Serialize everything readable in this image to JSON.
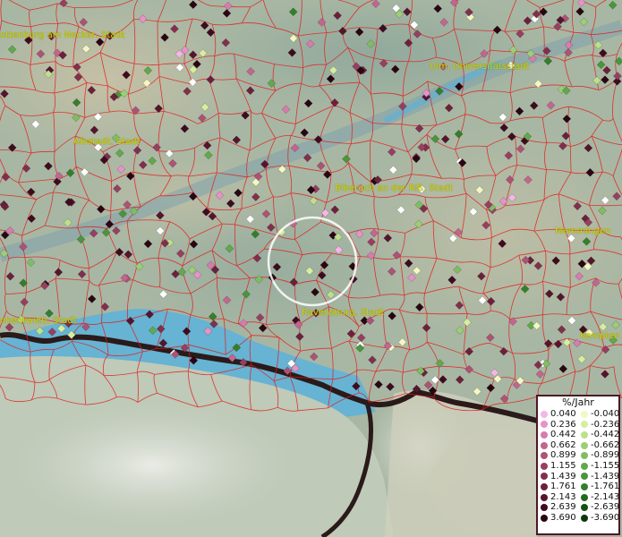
{
  "map": {
    "cities": [
      {
        "id": "rottenburg",
        "label": "ottenburg am Neckar, Stadt"
      },
      {
        "id": "ulm",
        "label": "Ulm, Universitätsstadt"
      },
      {
        "id": "albstadt",
        "label": "Albstadt, Stadt"
      },
      {
        "id": "biberach",
        "label": "Biberach an der Riß, Stadt"
      },
      {
        "id": "memmingen",
        "label": "Memmingen"
      },
      {
        "id": "ravensburg",
        "label": "Ravensburg, Stadt"
      },
      {
        "id": "singen",
        "label": "ohentwiel), Stadt"
      },
      {
        "id": "kempten",
        "label": "Kempten ("
      }
    ],
    "colors": {
      "boundary": "#e21c1c",
      "lake": "#6fb6d8",
      "border": "#1a1a1a",
      "selection_circle": "#ffffff"
    }
  },
  "legend": {
    "title": "%/Jahr",
    "rows": [
      {
        "pos": "0.040",
        "pos_color": "#f4b6e6",
        "neg": "-0.040",
        "neg_color": "#f3f7c2"
      },
      {
        "pos": "0.236",
        "pos_color": "#e693c9",
        "neg": "-0.236",
        "neg_color": "#d7ed9f"
      },
      {
        "pos": "0.442",
        "pos_color": "#d67cae",
        "neg": "-0.442",
        "neg_color": "#bde08b"
      },
      {
        "pos": "0.662",
        "pos_color": "#c2668f",
        "neg": "-0.662",
        "neg_color": "#9cce77"
      },
      {
        "pos": "0.899",
        "pos_color": "#ad5376",
        "neg": "-0.899",
        "neg_color": "#7fbd63"
      },
      {
        "pos": "1.155",
        "pos_color": "#983f60",
        "neg": "-1.155",
        "neg_color": "#60a94c"
      },
      {
        "pos": "1.439",
        "pos_color": "#822f4d",
        "neg": "-1.439",
        "neg_color": "#4a963b"
      },
      {
        "pos": "1.761",
        "pos_color": "#6b213c",
        "neg": "-1.761",
        "neg_color": "#347f2b"
      },
      {
        "pos": "2.143",
        "pos_color": "#55152d",
        "neg": "-2.143",
        "neg_color": "#236a1e"
      },
      {
        "pos": "2.639",
        "pos_color": "#3e0b1f",
        "neg": "-2.639",
        "neg_color": "#145214"
      },
      {
        "pos": "3.690",
        "pos_color": "#2a0512",
        "neg": "-3.690",
        "neg_color": "#0a3a0a"
      }
    ]
  }
}
